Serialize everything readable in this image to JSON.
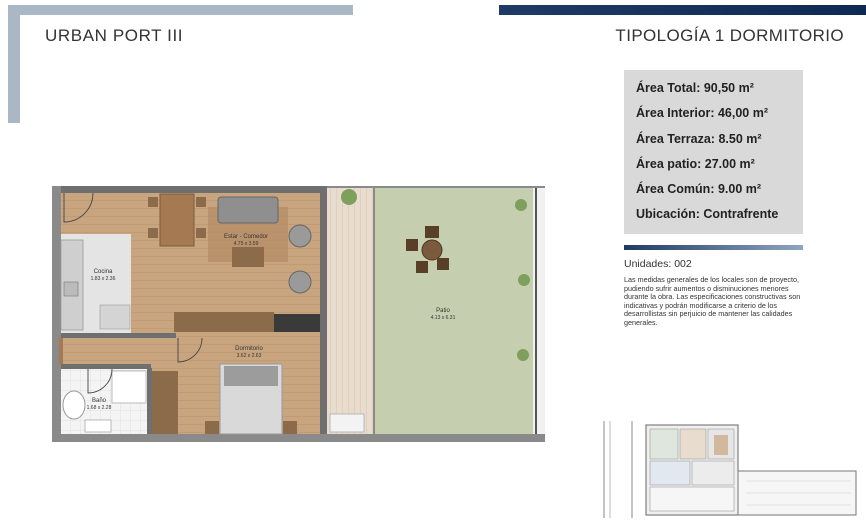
{
  "header": {
    "project_name": "URBAN PORT III",
    "typology": "TIPOLOGÍA 1 DORMITORIO"
  },
  "areas": [
    "Área Total: 90,50 m²",
    "Área Interior: 46,00 m²",
    "Área Terraza: 8.50 m²",
    "Área patio: 27.00 m²",
    "Área Común: 9.00 m²",
    "Ubicación: Contrafrente"
  ],
  "units": "Unidades: 002",
  "notes": "Las medidas generales de los locales son de proyecto, pudiendo sufrir aumentos o disminuciones menores durante la obra. Las especificaciones constructivas son indicativas y podrán modificarse a criterio de los desarrollistas sin perjuicio de mantener las calidades generales.",
  "rooms": {
    "living": {
      "name": "Estar - Comedor",
      "dims": "4.75 x 3.59"
    },
    "kitchen": {
      "name": "Cocina",
      "dims": "1.83 x 2.36"
    },
    "bedroom": {
      "name": "Dormitorio",
      "dims": "3.62 x 2.63"
    },
    "bath": {
      "name": "Baño",
      "dims": "1.68 x 2.28"
    },
    "patio": {
      "name": "Patio",
      "dims": "4.13 x 6.31"
    }
  },
  "colors": {
    "wall": "#6f6f6f",
    "wood": "#c9a57f",
    "grass": "#c5cfb0",
    "terrace": "#e8dccf",
    "navy": "#1f3b63",
    "light_blue": "#a9b8c4"
  }
}
